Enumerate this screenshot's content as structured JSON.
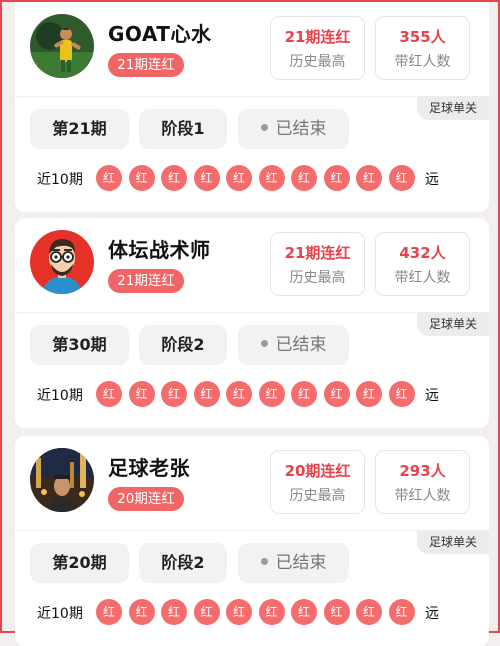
{
  "experts": [
    {
      "name": "GOAT心水",
      "streak_badge": "21期连红",
      "best_value": "21期连红",
      "best_label": "历史最高",
      "followers_value": "355人",
      "followers_label": "带红人数",
      "category_tag": "足球单关",
      "period": "第21期",
      "stage": "阶段1",
      "status": "已结束",
      "recent_label": "近10期",
      "results": [
        "红",
        "红",
        "红",
        "红",
        "红",
        "红",
        "红",
        "红",
        "红",
        "红"
      ],
      "far_label": "远",
      "avatar_icon": "soccer-player-avatar"
    },
    {
      "name": "体坛战术师",
      "streak_badge": "21期连红",
      "best_value": "21期连红",
      "best_label": "历史最高",
      "followers_value": "432人",
      "followers_label": "带红人数",
      "category_tag": "足球单关",
      "period": "第30期",
      "stage": "阶段2",
      "status": "已结束",
      "recent_label": "近10期",
      "results": [
        "红",
        "红",
        "红",
        "红",
        "红",
        "红",
        "红",
        "红",
        "红",
        "红"
      ],
      "far_label": "远",
      "avatar_icon": "cartoon-man-glasses-avatar"
    },
    {
      "name": "足球老张",
      "streak_badge": "20期连红",
      "best_value": "20期连红",
      "best_label": "历史最高",
      "followers_value": "293人",
      "followers_label": "带红人数",
      "category_tag": "足球单关",
      "period": "第20期",
      "stage": "阶段2",
      "status": "已结束",
      "recent_label": "近10期",
      "results": [
        "红",
        "红",
        "红",
        "红",
        "红",
        "红",
        "红",
        "红",
        "红",
        "红"
      ],
      "far_label": "远",
      "avatar_icon": "man-night-city-avatar"
    }
  ],
  "colors": {
    "accent": "#e8424a",
    "badge_bg": "#f26567",
    "ball_bg": "#f56c6c",
    "page_bg": "#f3efef"
  }
}
